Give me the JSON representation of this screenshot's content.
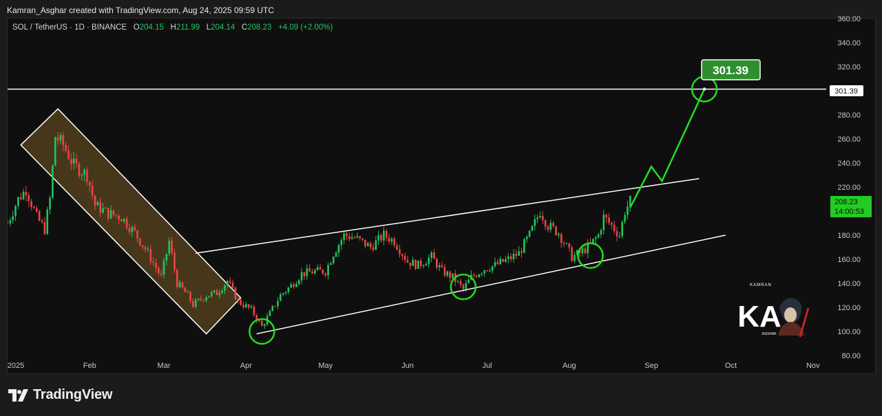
{
  "header": {
    "attribution": "Kamran_Asghar created with TradingView.com, Aug 24, 2025 09:59 UTC"
  },
  "legend": {
    "symbol": "SOL / TetherUS · 1D · BINANCE",
    "open_label": "O",
    "open": "204.15",
    "high_label": "H",
    "high": "211.99",
    "low_label": "L",
    "low": "204.14",
    "close_label": "C",
    "close": "208.23",
    "change": "+4.09 (+2.00%)"
  },
  "target_callout": "301.39",
  "price_tags": {
    "target": "301.39",
    "last": "208.23",
    "countdown": "14:00:53"
  },
  "watermark": {
    "top": "KAMRAN",
    "logo": "KA",
    "bottom": "ASGHAR"
  },
  "footer": {
    "logo_text": "TradingView"
  },
  "colors": {
    "bull": "#22c55e",
    "bear": "#ef4444",
    "projection": "#22dd22",
    "channel_fill": "#5a4520",
    "background": "#0f0f0f"
  },
  "chart_data": {
    "type": "candlestick",
    "title": "SOL / TetherUS · 1D · BINANCE",
    "y_ticks": [
      360,
      340,
      320,
      300,
      280,
      260,
      240,
      220,
      200,
      180,
      160,
      140,
      120,
      100,
      80
    ],
    "y_tick_labels": [
      "360.00",
      "340.00",
      "320.00",
      "300.00",
      "280.00",
      "260.00",
      "240.00",
      "220.00",
      "200.00",
      "180.00",
      "160.00",
      "140.00",
      "120.00",
      "100.00",
      "80.00"
    ],
    "x_ticks": [
      "2025",
      "Feb",
      "Mar",
      "Apr",
      "May",
      "Jun",
      "Jul",
      "Aug",
      "Sep",
      "Oct",
      "Nov"
    ],
    "x_tick_dates": [
      "2025-01-01",
      "2025-02-01",
      "2025-03-01",
      "2025-04-01",
      "2025-05-01",
      "2025-06-01",
      "2025-07-01",
      "2025-08-01",
      "2025-09-01",
      "2025-10-01",
      "2025-11-01"
    ],
    "ylim": [
      80,
      360
    ],
    "xlim": [
      "2025-01-01",
      "2025-11-06"
    ],
    "grid": false,
    "close_path": [
      {
        "x": "2025-01-01",
        "y": 190
      },
      {
        "x": "2025-01-05",
        "y": 210
      },
      {
        "x": "2025-01-08",
        "y": 218
      },
      {
        "x": "2025-01-12",
        "y": 195
      },
      {
        "x": "2025-01-15",
        "y": 185
      },
      {
        "x": "2025-01-17",
        "y": 210
      },
      {
        "x": "2025-01-19",
        "y": 262
      },
      {
        "x": "2025-01-22",
        "y": 255
      },
      {
        "x": "2025-01-26",
        "y": 238
      },
      {
        "x": "2025-01-31",
        "y": 230
      },
      {
        "x": "2025-02-03",
        "y": 205
      },
      {
        "x": "2025-02-08",
        "y": 198
      },
      {
        "x": "2025-02-13",
        "y": 195
      },
      {
        "x": "2025-02-18",
        "y": 182
      },
      {
        "x": "2025-02-23",
        "y": 165
      },
      {
        "x": "2025-02-28",
        "y": 145
      },
      {
        "x": "2025-03-03",
        "y": 175
      },
      {
        "x": "2025-03-06",
        "y": 140
      },
      {
        "x": "2025-03-10",
        "y": 130
      },
      {
        "x": "2025-03-12",
        "y": 122
      },
      {
        "x": "2025-03-17",
        "y": 130
      },
      {
        "x": "2025-03-21",
        "y": 132
      },
      {
        "x": "2025-03-25",
        "y": 142
      },
      {
        "x": "2025-03-29",
        "y": 125
      },
      {
        "x": "2025-04-03",
        "y": 118
      },
      {
        "x": "2025-04-07",
        "y": 104
      },
      {
        "x": "2025-04-10",
        "y": 115
      },
      {
        "x": "2025-04-14",
        "y": 130
      },
      {
        "x": "2025-04-18",
        "y": 138
      },
      {
        "x": "2025-04-22",
        "y": 148
      },
      {
        "x": "2025-04-27",
        "y": 150
      },
      {
        "x": "2025-05-01",
        "y": 150
      },
      {
        "x": "2025-05-04",
        "y": 165
      },
      {
        "x": "2025-05-08",
        "y": 180
      },
      {
        "x": "2025-05-12",
        "y": 178
      },
      {
        "x": "2025-05-18",
        "y": 170
      },
      {
        "x": "2025-05-23",
        "y": 180
      },
      {
        "x": "2025-05-27",
        "y": 175
      },
      {
        "x": "2025-06-01",
        "y": 158
      },
      {
        "x": "2025-06-05",
        "y": 155
      },
      {
        "x": "2025-06-10",
        "y": 162
      },
      {
        "x": "2025-06-14",
        "y": 150
      },
      {
        "x": "2025-06-18",
        "y": 145
      },
      {
        "x": "2025-06-22",
        "y": 135
      },
      {
        "x": "2025-06-25",
        "y": 145
      },
      {
        "x": "2025-06-30",
        "y": 152
      },
      {
        "x": "2025-07-04",
        "y": 155
      },
      {
        "x": "2025-07-09",
        "y": 160
      },
      {
        "x": "2025-07-13",
        "y": 165
      },
      {
        "x": "2025-07-17",
        "y": 180
      },
      {
        "x": "2025-07-21",
        "y": 200
      },
      {
        "x": "2025-07-24",
        "y": 188
      },
      {
        "x": "2025-07-28",
        "y": 182
      },
      {
        "x": "2025-08-02",
        "y": 162
      },
      {
        "x": "2025-08-05",
        "y": 165
      },
      {
        "x": "2025-08-09",
        "y": 172
      },
      {
        "x": "2025-08-12",
        "y": 180
      },
      {
        "x": "2025-08-14",
        "y": 195
      },
      {
        "x": "2025-08-17",
        "y": 188
      },
      {
        "x": "2025-08-20",
        "y": 180
      },
      {
        "x": "2025-08-22",
        "y": 200
      },
      {
        "x": "2025-08-24",
        "y": 208.23
      }
    ],
    "horizontal_line": {
      "y": 301.39
    },
    "falling_channel": [
      {
        "x": "2025-01-06",
        "y": 255
      },
      {
        "x": "2025-01-20",
        "y": 285
      },
      {
        "x": "2025-03-30",
        "y": 128
      },
      {
        "x": "2025-03-17",
        "y": 98
      }
    ],
    "upper_trendline": [
      {
        "x": "2025-03-13",
        "y": 165
      },
      {
        "x": "2025-09-19",
        "y": 227
      }
    ],
    "lower_trendline": [
      {
        "x": "2025-04-05",
        "y": 98
      },
      {
        "x": "2025-09-29",
        "y": 180
      }
    ],
    "projection_path": [
      {
        "x": "2025-08-24",
        "y": 203
      },
      {
        "x": "2025-09-01",
        "y": 237
      },
      {
        "x": "2025-09-05",
        "y": 225
      },
      {
        "x": "2025-09-21",
        "y": 301.39
      }
    ],
    "circles": [
      {
        "x": "2025-04-07",
        "y": 100
      },
      {
        "x": "2025-06-22",
        "y": 137
      },
      {
        "x": "2025-08-09",
        "y": 163
      },
      {
        "x": "2025-09-21",
        "y": 301.39
      }
    ]
  }
}
